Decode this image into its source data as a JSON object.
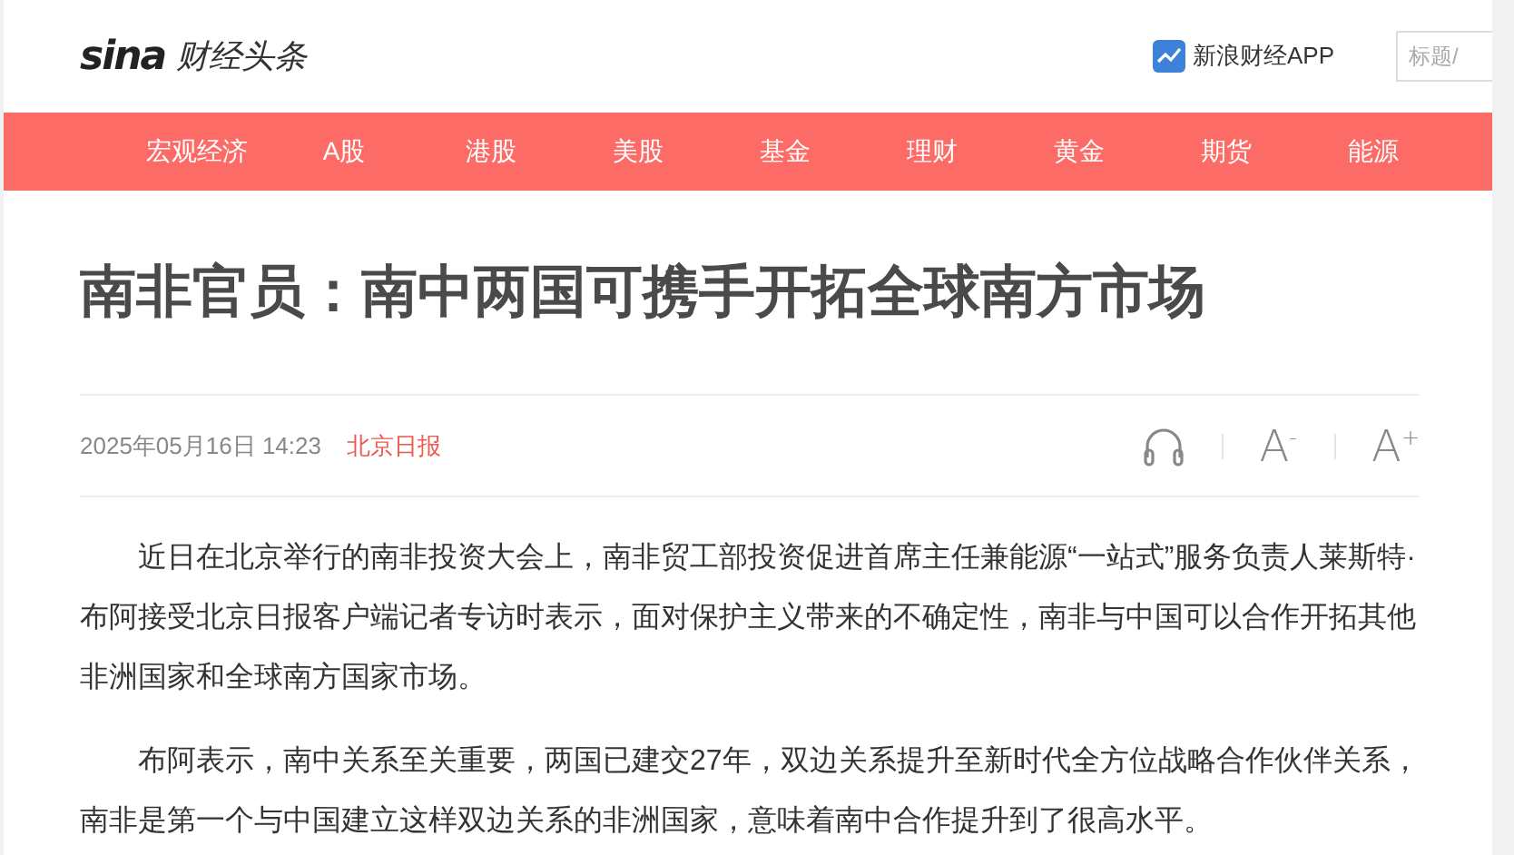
{
  "header": {
    "logo": "sina",
    "channel": "财经头条",
    "app_link": "新浪财经APP",
    "search": {
      "placeholder": "标题/"
    }
  },
  "nav": [
    {
      "label": "宏观经济"
    },
    {
      "label": "A股"
    },
    {
      "label": "港股"
    },
    {
      "label": "美股"
    },
    {
      "label": "基金"
    },
    {
      "label": "理财"
    },
    {
      "label": "黄金"
    },
    {
      "label": "期货"
    },
    {
      "label": "能源"
    }
  ],
  "article": {
    "title": "南非官员：南中两国可携手开拓全球南方市场",
    "date": "2025年05月16日 14:23",
    "source": "北京日报",
    "tools": [
      {
        "kind": "listen"
      },
      {
        "kind": "font",
        "label": "A$^{-}$"
      },
      {
        "kind": "font",
        "label": "A$^{+}$"
      }
    ],
    "paragraphs": [
      "近日在北京举行的南非投资大会上，南非贸工部投资促进首席主任兼能源“一站式”服务负责人莱斯特·布阿接受北京日报客户端记者专访时表示，面对保护主义带来的不确定性，南非与中国可以合作开拓其他非洲国家和全球南方国家市场。",
      "布阿表示，南中关系至关重要，两国已建交27年，双边关系提升至新时代全方位战略合作伙伴关系，南非是第一个与中国建立这样双边关系的非洲国家，意味着南中合作提升到了很高水平。"
    ]
  }
}
